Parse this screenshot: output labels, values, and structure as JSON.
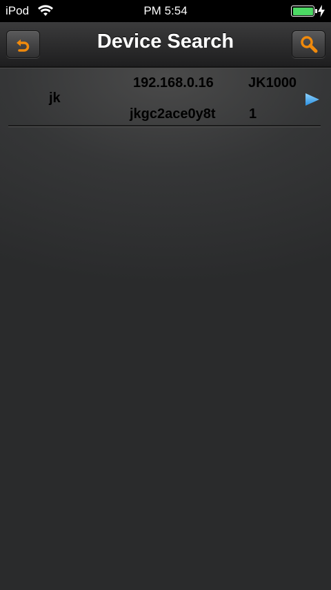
{
  "status_bar": {
    "carrier": "iPod",
    "time": "PM 5:54",
    "battery_color": "#4cd964"
  },
  "nav": {
    "title": "Device Search",
    "back_icon": "back-arrow-icon",
    "search_icon": "magnifier-icon",
    "accent_color": "#f08a0c"
  },
  "devices": [
    {
      "name": "jk",
      "ip": "192.168.0.16",
      "model": "JK1000",
      "id": "jkgc2ace0y8t",
      "channel": "1"
    }
  ]
}
